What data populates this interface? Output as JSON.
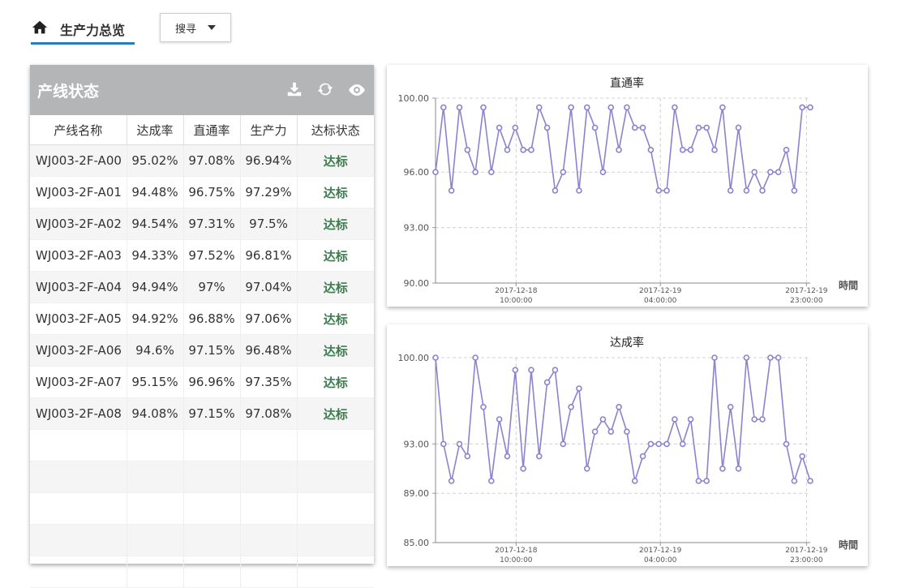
{
  "nav": {
    "home_title": "生产力总览",
    "search_label": "搜寻"
  },
  "panel": {
    "title": "产线状态",
    "columns": [
      "产线名称",
      "达成率",
      "直通率",
      "生产力",
      "达标状态"
    ],
    "rows": [
      [
        "WJ003-2F-A00",
        "95.02%",
        "97.08%",
        "96.94%",
        "达标"
      ],
      [
        "WJ003-2F-A01",
        "94.48%",
        "96.75%",
        "97.29%",
        "达标"
      ],
      [
        "WJ003-2F-A02",
        "94.54%",
        "97.31%",
        "97.5%",
        "达标"
      ],
      [
        "WJ003-2F-A03",
        "94.33%",
        "97.52%",
        "96.81%",
        "达标"
      ],
      [
        "WJ003-2F-A04",
        "94.94%",
        "97%",
        "97.04%",
        "达标"
      ],
      [
        "WJ003-2F-A05",
        "94.92%",
        "96.88%",
        "97.06%",
        "达标"
      ],
      [
        "WJ003-2F-A06",
        "94.6%",
        "97.15%",
        "96.48%",
        "达标"
      ],
      [
        "WJ003-2F-A07",
        "95.15%",
        "96.96%",
        "97.35%",
        "达标"
      ],
      [
        "WJ003-2F-A08",
        "94.08%",
        "97.15%",
        "97.08%",
        "达标"
      ]
    ],
    "empty_rows": 5,
    "icons": [
      "download-icon",
      "refresh-icon",
      "eye-icon"
    ]
  },
  "colors": {
    "line": "#8a83cf",
    "ok": "#3c7d4f",
    "header": "#b3b5b6",
    "accent": "#2b7bc0"
  },
  "chart_data": [
    {
      "type": "line",
      "title": "直通率",
      "xlabel": "時間",
      "ylabel": "",
      "yticks": [
        "90.00",
        "93.00",
        "96.00",
        "100.00"
      ],
      "ylim": [
        90,
        100
      ],
      "xticks": [
        [
          "2017-12-18",
          "10:00:00"
        ],
        [
          "2017-12-19",
          "04:00:00"
        ],
        [
          "2017-12-19",
          "23:00:00"
        ]
      ],
      "grid": true,
      "values": [
        96,
        99.5,
        95,
        99.5,
        97.2,
        96,
        99.5,
        96,
        98.4,
        97.2,
        98.4,
        97.2,
        97.2,
        99.5,
        98.4,
        95,
        96,
        99.5,
        95,
        99.5,
        98.4,
        96,
        99.5,
        97.2,
        99.5,
        98.4,
        98.4,
        97.2,
        95,
        95,
        99.5,
        97.2,
        97.2,
        98.4,
        98.4,
        97.2,
        99.5,
        95,
        98.4,
        95,
        96,
        95,
        96,
        96,
        97.2,
        95,
        99.5,
        99.5
      ]
    },
    {
      "type": "line",
      "title": "达成率",
      "xlabel": "時間",
      "ylabel": "",
      "yticks": [
        "85.00",
        "89.00",
        "93.00",
        "100.00"
      ],
      "ylim": [
        85,
        100
      ],
      "xticks": [
        [
          "2017-12-18",
          "10:00:00"
        ],
        [
          "2017-12-19",
          "04:00:00"
        ],
        [
          "2017-12-19",
          "23:00:00"
        ]
      ],
      "grid": true,
      "values": [
        100,
        93,
        90,
        93,
        92,
        100,
        96,
        90,
        95,
        92,
        99,
        91,
        99,
        92,
        98,
        99,
        93,
        96,
        97.5,
        91,
        94,
        95,
        94,
        96,
        94,
        90,
        92,
        93,
        93,
        93,
        95,
        93,
        95,
        90,
        90,
        100,
        91,
        96,
        91,
        100,
        95,
        95,
        100,
        100,
        93,
        90,
        92,
        90
      ]
    }
  ]
}
